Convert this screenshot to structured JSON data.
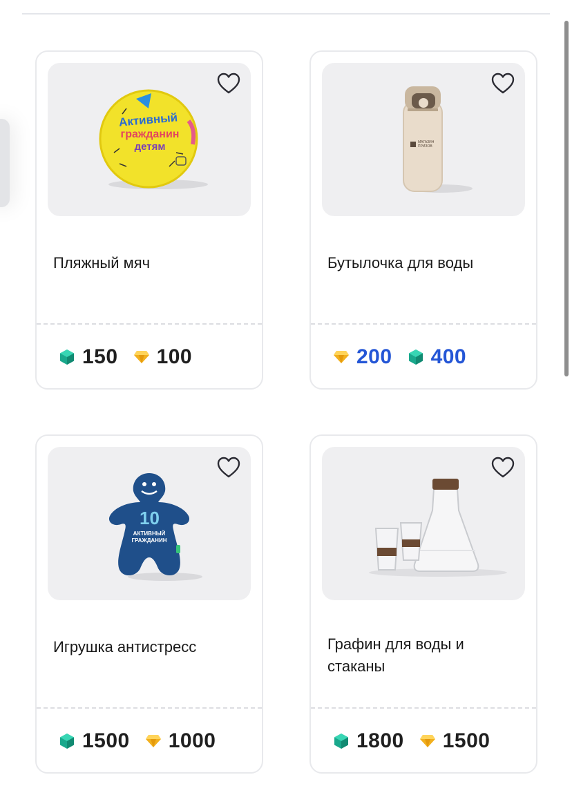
{
  "icons": {
    "favorite": "heart-outline-icon",
    "crystal": "green-crystal-icon",
    "diamond": "gold-diamond-icon"
  },
  "colors": {
    "price_default": "#1f1f1f",
    "price_highlight": "#2456d6",
    "crystal": "#1fb89a",
    "diamond": "#f2b01e"
  },
  "products": [
    {
      "title": "Пляжный мяч",
      "prices": [
        {
          "currency": "crystal",
          "value": "150"
        },
        {
          "currency": "diamond",
          "value": "100"
        }
      ]
    },
    {
      "title": "Бутылочка для воды",
      "highlight": true,
      "prices": [
        {
          "currency": "diamond",
          "value": "200"
        },
        {
          "currency": "crystal",
          "value": "400"
        }
      ]
    },
    {
      "title": "Игрушка антистресс",
      "prices": [
        {
          "currency": "crystal",
          "value": "1500"
        },
        {
          "currency": "diamond",
          "value": "1000"
        }
      ]
    },
    {
      "title": "Графин для воды и стаканы",
      "prices": [
        {
          "currency": "crystal",
          "value": "1800"
        },
        {
          "currency": "diamond",
          "value": "1500"
        }
      ]
    }
  ],
  "ball_print": [
    "Активный",
    "гражданин",
    "детям"
  ],
  "bottle_print": [
    "МАГАЗИН",
    "ПРИЗОВ"
  ],
  "toy_print": [
    "10",
    "АКТИВНЫЙ",
    "ГРАЖДАНИН"
  ]
}
